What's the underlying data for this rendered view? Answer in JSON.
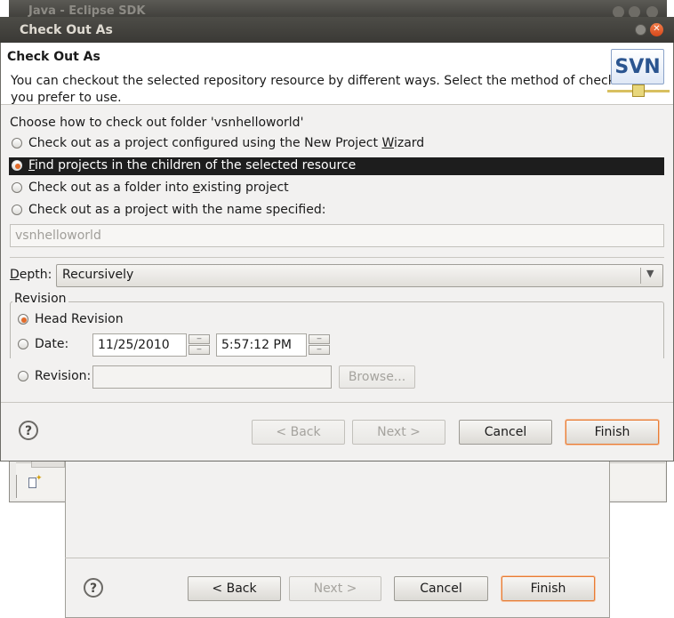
{
  "background_window": {
    "title": "Java - Eclipse SDK"
  },
  "back_dialog": {
    "buttons": {
      "back": "< Back",
      "next": "Next >",
      "cancel": "Cancel",
      "finish": "Finish"
    }
  },
  "dialog": {
    "title": "Check Out As",
    "banner": {
      "heading": "Check Out As",
      "description": "You can checkout the selected repository resource by different ways. Select the method of checkout you prefer to use.",
      "description_line1": "You can checkout the selected repository resource by different ways. Select the method of checkout",
      "description_line2": "you prefer to use.",
      "logo_text": "SVN"
    },
    "prompt": "Choose how to check out folder 'vsnhelloworld'",
    "options": [
      {
        "label": "Check out as a project configured using the New Project Wizard",
        "selected": false
      },
      {
        "label": "Find projects in the children of the selected resource",
        "selected": true
      },
      {
        "label": "Check out as a folder into existing project",
        "selected": false
      },
      {
        "label": "Check out as a project with the name specified:",
        "selected": false
      }
    ],
    "project_name": {
      "value": "vsnhelloworld",
      "enabled": false
    },
    "depth": {
      "label": "Depth:",
      "value": "Recursively"
    },
    "revision_group": {
      "title": "Revision",
      "head_label": "Head Revision",
      "head_selected": true,
      "date_label": "Date:",
      "date_value": "11/25/2010",
      "time_value": "5:57:12 PM",
      "revision_label": "Revision:",
      "revision_value": "",
      "browse_label": "Browse..."
    },
    "buttons": {
      "back": "< Back",
      "next": "Next >",
      "cancel": "Cancel",
      "finish": "Finish"
    },
    "colors": {
      "accent": "#e26b2a",
      "selection": "#1d1d1d",
      "titlebar": "#3c3b37"
    }
  }
}
